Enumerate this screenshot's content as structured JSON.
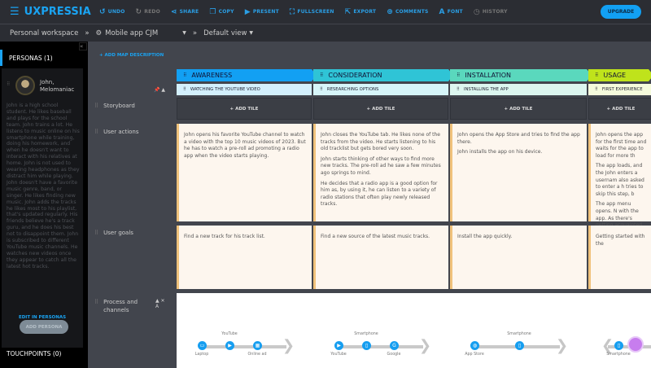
{
  "app": {
    "name": "UXPRESSIA",
    "menu_icon": "hamburger-icon"
  },
  "toolbar": [
    {
      "label": "UNDO",
      "icon": "undo-icon",
      "enabled": true
    },
    {
      "label": "REDO",
      "icon": "redo-icon",
      "enabled": false
    },
    {
      "label": "SHARE",
      "icon": "share-icon",
      "enabled": true
    },
    {
      "label": "COPY",
      "icon": "copy-icon",
      "enabled": true
    },
    {
      "label": "PRESENT",
      "icon": "present-icon",
      "enabled": true
    },
    {
      "label": "FULLSCREEN",
      "icon": "fullscreen-icon",
      "enabled": true
    },
    {
      "label": "EXPORT",
      "icon": "export-icon",
      "enabled": true
    },
    {
      "label": "COMMENTS",
      "icon": "comments-icon",
      "enabled": true
    },
    {
      "label": "FONT",
      "icon": "font-icon",
      "enabled": true
    },
    {
      "label": "HISTORY",
      "icon": "history-icon",
      "enabled": false
    }
  ],
  "upgrade": "UPGRADE",
  "breadcrumb": {
    "workspace": "Personal workspace",
    "map": "Mobile app CJM",
    "view": "Default view"
  },
  "sidebar": {
    "personas_title": "PERSONAS (1)",
    "persona": {
      "name": "John, Melomaniac",
      "description": "John is a high school student. He likes baseball and plays for the school team. John trains a lot. He listens to music online on his smartphone while training, doing his homework, and when he doesn't want to interact with his relatives at home. John is not used to wearing headphones as they distract him while playing. John doesn't have a favorite music genre, band, or singer. He likes finding new music. John adds the tracks he likes most to his playlist, that's updated regularly. His friends believe he's a track guru, and he does his best not to disappoint them. John is subscribed to different YouTube music channels. He watches new videos once they appear to catch all the latest hot tracks."
    },
    "edit_link": "EDIT IN PERSONAS",
    "add_persona": "ADD PERSONA",
    "touchpoints_title": "TOUCHPOINTS (0)"
  },
  "map": {
    "add_description": "+ ADD MAP DESCRIPTION",
    "add_tile": "+ ADD TILE",
    "rows": [
      "Storyboard",
      "User actions",
      "User goals",
      "Process and channels"
    ],
    "stages": [
      {
        "name": "AWARENESS",
        "color": "#12a0f3",
        "sub": "WATCHING THE YOUTUBE VIDEO",
        "sub_color": "#d3f0fd",
        "actions": [
          "John opens his favorite YouTube channel to watch a video with the top 10 music videos of 2023. But he has to watch a pre-roll ad promoting a radio app when the video starts playing."
        ],
        "goal": "Find a new track for his track list."
      },
      {
        "name": "CONSIDERATION",
        "color": "#2fc4d6",
        "sub": "RESEARCHING OPTIONS",
        "sub_color": "#d6f5f9",
        "actions": [
          "John closes the YouTube tab. He likes none of the tracks from the video. He starts listening to his old tracklist but gets bored very soon.",
          "John starts thinking of other ways to find more new tracks. The pre-roll ad he saw a few minutes ago springs to mind.",
          "He decides that a radio app is a good option for him as, by using it, he can listen to a variety of radio stations that often play newly released tracks."
        ],
        "goal": "Find a new source of the latest music tracks."
      },
      {
        "name": "INSTALLATION",
        "color": "#5ad8bd",
        "sub": "INSTALLING THE APP",
        "sub_color": "#dcf6ef",
        "actions": [
          "John opens the App Store and tries to find the app there.",
          "John installs the app on his device."
        ],
        "goal": "Install the app quickly."
      },
      {
        "name": "USAGE",
        "color": "#bfe31b",
        "sub": "FIRST EXPERIENCE",
        "sub_color": "#f5fbdc",
        "actions": [
          "John opens the app for the first time and waits for the app to load for more th",
          "The app loads, and the John enters a usernam also asked to enter a h tries to skip this step, b",
          "The app menu opens. N with the app. As there's getting acquainted wit"
        ],
        "goal": "Getting started with the"
      }
    ],
    "channels": [
      {
        "nodes": [
          {
            "label": "Laptop",
            "icon": "laptop-icon",
            "pos": "below"
          },
          {
            "label": "YouTube",
            "icon": "youtube-icon",
            "pos": "above"
          },
          {
            "label": "Online ad",
            "icon": "ad-icon",
            "pos": "below"
          }
        ]
      },
      {
        "nodes": [
          {
            "label": "YouTube",
            "icon": "youtube-icon",
            "pos": "below"
          },
          {
            "label": "Smartphone",
            "icon": "smartphone-icon",
            "pos": "above"
          },
          {
            "label": "Google",
            "icon": "google-icon",
            "pos": "below"
          }
        ]
      },
      {
        "nodes": [
          {
            "label": "App Store",
            "icon": "globe-icon",
            "pos": "below"
          },
          {
            "label": "Smartphone",
            "icon": "smartphone-icon",
            "pos": "above"
          }
        ]
      },
      {
        "nodes": [
          {
            "label": "Smartphone",
            "icon": "smartphone-icon",
            "pos": "below"
          }
        ]
      }
    ]
  }
}
